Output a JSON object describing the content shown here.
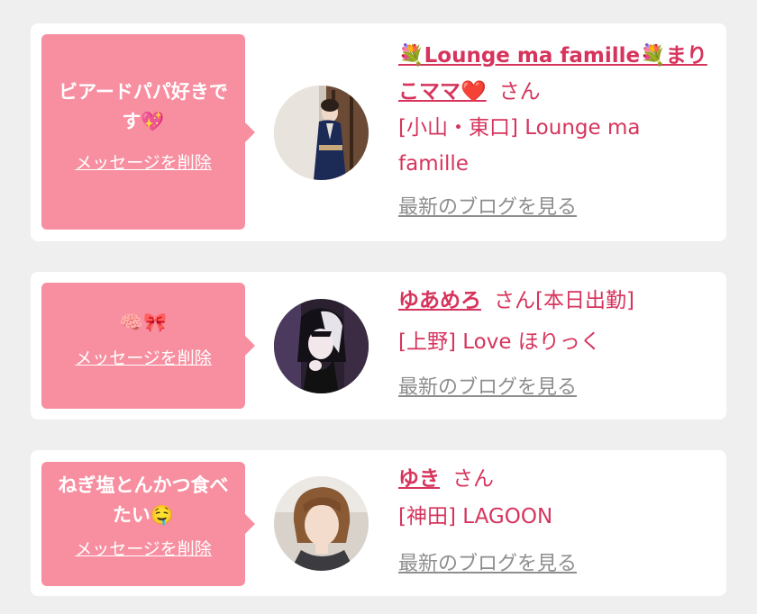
{
  "messages": [
    {
      "bubble_text": "ビアードパパ好きです💖",
      "delete_label": "メッセージを削除",
      "name": "💐Lounge ma famille💐まりこママ❤️",
      "san": "さん",
      "shop_line": "[小山・東口] Lounge ma famille",
      "blog_label": "最新のブログを見る"
    },
    {
      "bubble_text": "🧠🎀",
      "delete_label": "メッセージを削除",
      "name": "ゆあめろ",
      "san": "さん[本日出勤]",
      "shop_line": "[上野] Love ほりっく",
      "blog_label": "最新のブログを見る"
    },
    {
      "bubble_text": "ねぎ塩とんかつ食べたい🤤",
      "delete_label": "メッセージを削除",
      "name": "ゆき",
      "san": "さん",
      "shop_line": "[神田] LAGOON",
      "blog_label": "最新のブログを見る"
    }
  ],
  "colors": {
    "bubble": "#f78fa0",
    "accent": "#d6345c",
    "link_gray": "#8e8e8e",
    "page_bg": "#efefef"
  }
}
